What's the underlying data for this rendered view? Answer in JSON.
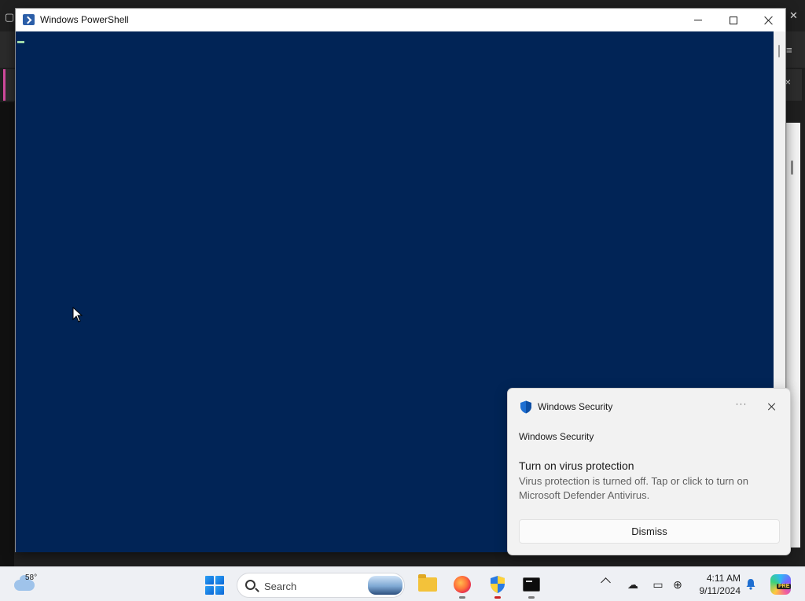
{
  "powershell": {
    "title": "Windows PowerShell"
  },
  "toast": {
    "app_title": "Windows Security",
    "more_label": "···",
    "source": "Windows Security",
    "heading": "Turn on virus protection",
    "body": "Virus protection is turned off. Tap or click to turn on Microsoft Defender Antivirus.",
    "dismiss_label": "Dismiss",
    "shield_color": "#1f6fd1"
  },
  "taskbar": {
    "weather_temp": "58°",
    "search_placeholder": "Search",
    "apps": [
      {
        "name": "File Explorer",
        "icon": "folder-icon"
      },
      {
        "name": "Firefox",
        "icon": "firefox-icon"
      },
      {
        "name": "Windows Security",
        "icon": "shield-icon"
      },
      {
        "name": "Windows PowerShell",
        "icon": "terminal-icon"
      }
    ],
    "time": "4:11 AM",
    "date": "9/11/2024",
    "copilot_badge": "PRE"
  },
  "colors": {
    "console_bg": "#012456",
    "taskbar_bg": "#eef0f4",
    "accent": "#0c67d6"
  }
}
